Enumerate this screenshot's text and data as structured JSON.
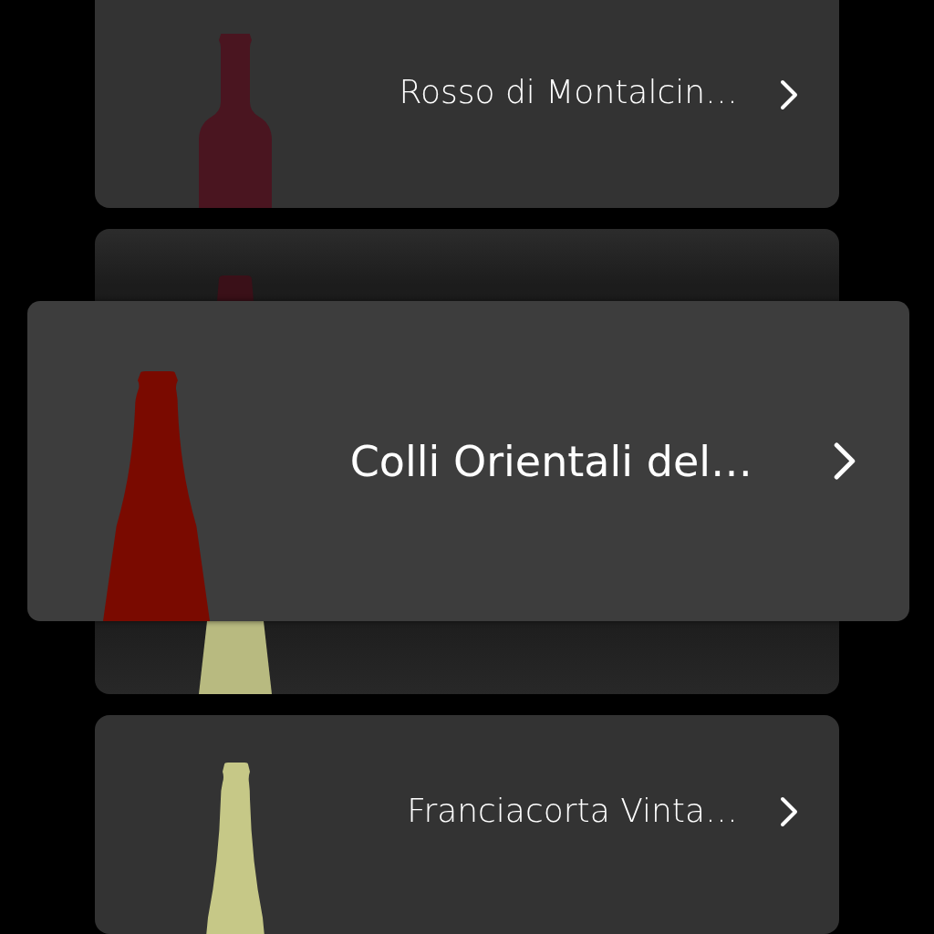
{
  "wines": [
    {
      "name": "Rosso di Montalcin…",
      "kind": "bordeaux",
      "color": "#4a1520",
      "lifted": false
    },
    {
      "name": "Colli Orientali del…",
      "kind": "sparkling",
      "color": "#7a0a00",
      "lifted": true
    },
    {
      "name": "Franciacorta Vinta…",
      "kind": "sparkling",
      "color": "#c6c887",
      "lifted": false
    }
  ]
}
